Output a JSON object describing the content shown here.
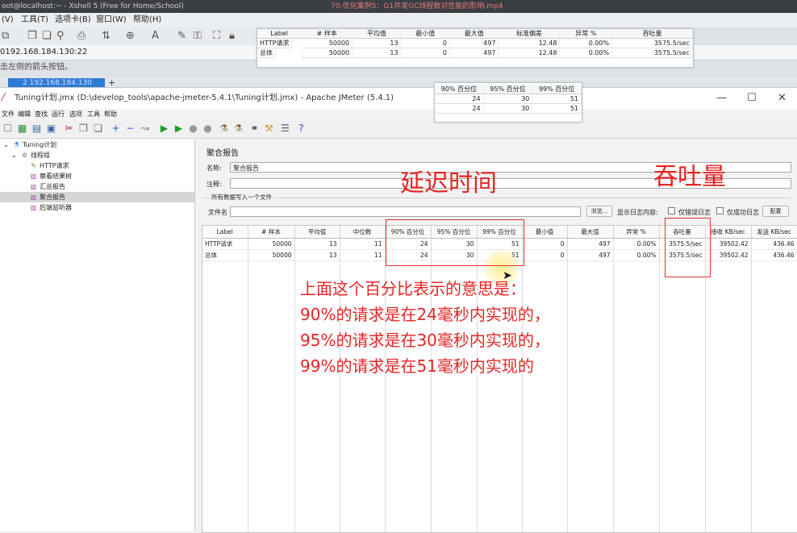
{
  "xshell": {
    "title": "oot@localhost:~ - Xshell 5 (Free for Home/School)",
    "video_title": "70-优化案例5：G1并发GC线程数对性能的影响.mp4",
    "menu": [
      "(V)",
      "工具(T)",
      "选项卡(B)",
      "窗口(W)",
      "帮助(H)"
    ],
    "address": "0192.168.184.130:22",
    "hint": "击左侧的箭头按钮。",
    "tab_label": "2 192.168.184.130",
    "tab_add": "+"
  },
  "overlay_stats": {
    "headers": [
      "Label",
      "# 样本",
      "平均值",
      "最小值",
      "最大值",
      "标准偏差",
      "异常 %",
      "吞吐量"
    ],
    "rows": [
      [
        "HTTP请求",
        "50000",
        "13",
        "0",
        "497",
        "12.48",
        "0.00%",
        "3575.5/sec"
      ],
      [
        "总体",
        "50000",
        "13",
        "0",
        "497",
        "12.48",
        "0.00%",
        "3575.5/sec"
      ]
    ]
  },
  "overlay_percentiles": {
    "headers": [
      "90% 百分位",
      "95% 百分位",
      "99% 百分位"
    ],
    "rows": [
      [
        "24",
        "30",
        "51"
      ],
      [
        "24",
        "30",
        "51"
      ]
    ]
  },
  "jmeter": {
    "window_title": "Tuning计划.jmx (D:\\develop_tools\\apache-jmeter-5.4.1\\Tuning计划.jmx) - Apache JMeter (5.4.1)",
    "window_controls": [
      "—",
      "☐",
      "✕"
    ],
    "menu": [
      "文件",
      "编辑",
      "查找",
      "运行",
      "选项",
      "工具",
      "帮助"
    ],
    "tree": [
      {
        "label": "Tuning计划",
        "icon": "flask-icon"
      },
      {
        "label": "线程组",
        "icon": "gear-icon"
      },
      {
        "label": "HTTP请求",
        "icon": "pencil-icon"
      },
      {
        "label": "察看结果树",
        "icon": "chart-icon"
      },
      {
        "label": "汇总报告",
        "icon": "chart-icon"
      },
      {
        "label": "聚合报告",
        "icon": "chart-icon"
      },
      {
        "label": "后端监听器",
        "icon": "chart-icon"
      }
    ],
    "panel": {
      "title": "聚合报告",
      "name_label": "名称:",
      "name_value": "聚合报告",
      "comment_label": "注释:",
      "comment_value": "",
      "write_all_label": "所有数据写入一个文件",
      "filename_label": "文件名",
      "browse_button": "浏览...",
      "log_label": "显示日志内容:",
      "errors_only": "仅错误日志",
      "success_only": "仅成功日志",
      "config_button": "配置"
    },
    "table": {
      "headers": [
        "Label",
        "# 样本",
        "平均值",
        "中位数",
        "90% 百分位",
        "95% 百分位",
        "99% 百分位",
        "最小值",
        "最大值",
        "异常 %",
        "吞吐量",
        "接收 KB/sec",
        "发送 KB/sec"
      ],
      "rows": [
        [
          "HTTP请求",
          "50000",
          "13",
          "11",
          "24",
          "30",
          "51",
          "0",
          "497",
          "0.00%",
          "3575.5/sec",
          "39502.42",
          "436.46"
        ],
        [
          "总体",
          "50000",
          "13",
          "11",
          "24",
          "30",
          "51",
          "0",
          "497",
          "0.00%",
          "3575.5/sec",
          "39502.42",
          "436.46"
        ]
      ]
    }
  },
  "annotations": {
    "latency": "延迟时间",
    "throughput": "吞吐量",
    "explain": [
      "上面这个百分比表示的意思是：",
      "90%的请求是在24毫秒内实现的，",
      "95%的请求是在30毫秒内实现的，",
      "99%的请求是在51毫秒内实现的"
    ],
    "color": "#e42525"
  }
}
